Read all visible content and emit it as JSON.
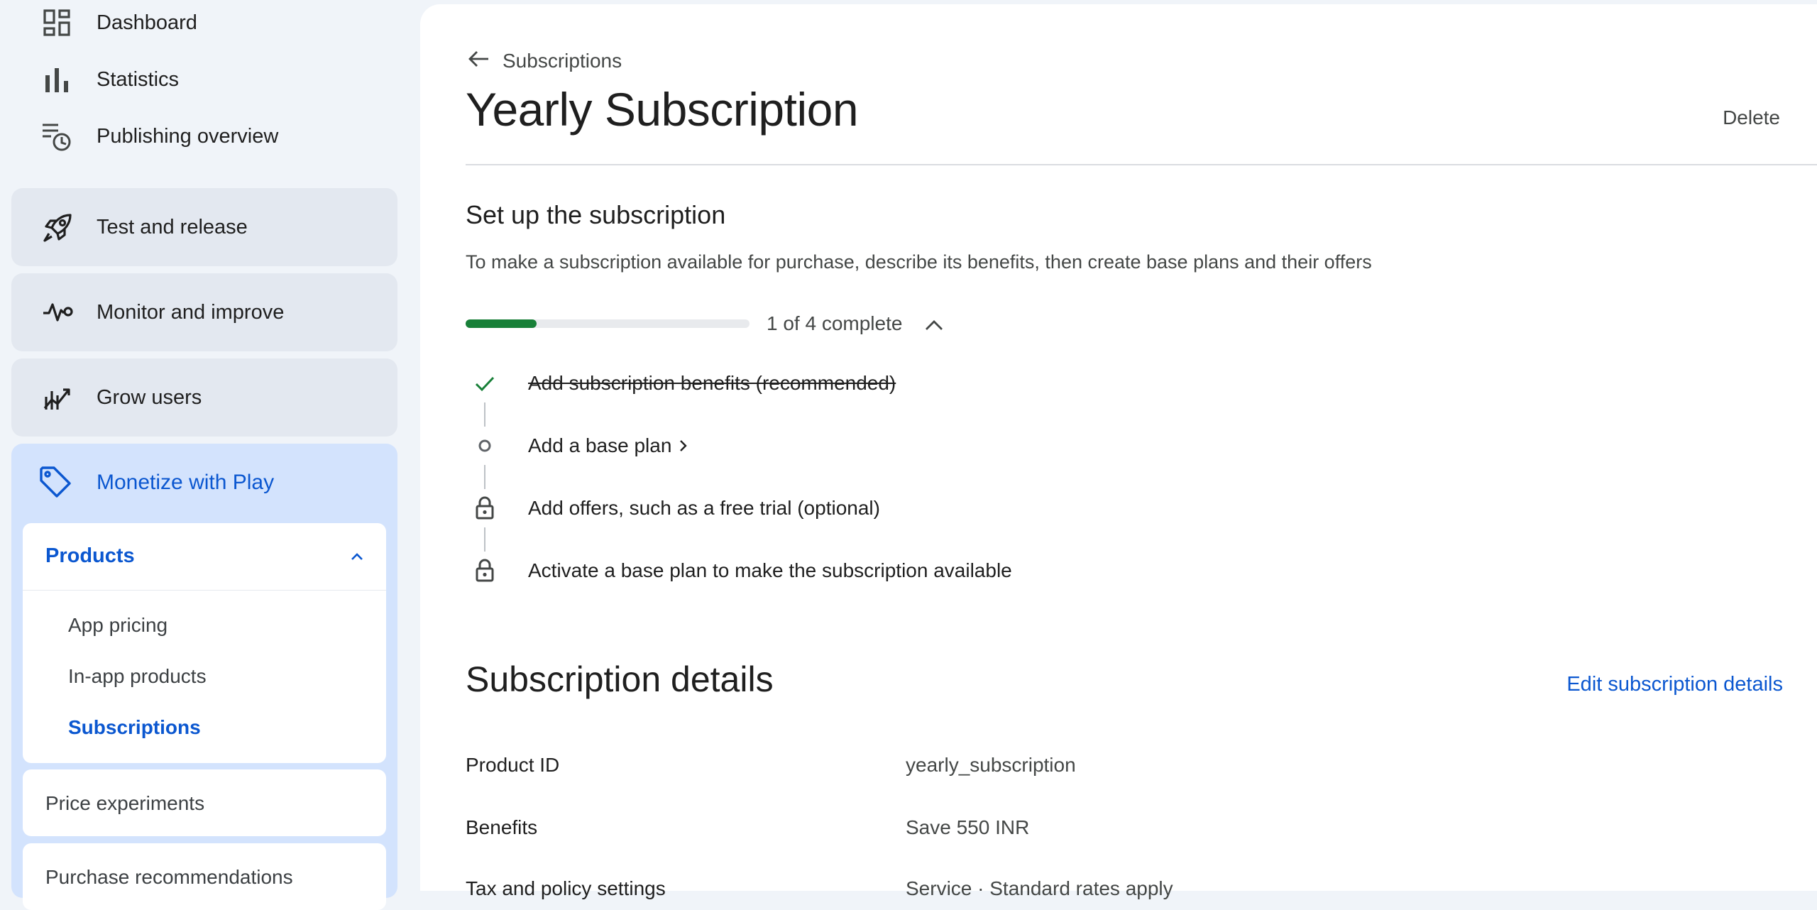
{
  "sidebar": {
    "top_items": [
      {
        "label": "Dashboard",
        "icon": "dashboard-icon"
      },
      {
        "label": "Statistics",
        "icon": "bar-chart-icon"
      },
      {
        "label": "Publishing overview",
        "icon": "publishing-clock-icon"
      }
    ],
    "sections": [
      {
        "label": "Test and release",
        "icon": "rocket-icon"
      },
      {
        "label": "Monitor and improve",
        "icon": "vitals-icon"
      },
      {
        "label": "Grow users",
        "icon": "grow-chart-icon"
      }
    ],
    "monetize": {
      "label": "Monetize with Play",
      "icon": "tag-icon",
      "products": {
        "label": "Products",
        "items": [
          "App pricing",
          "In-app products",
          "Subscriptions"
        ],
        "active": "Subscriptions"
      },
      "more": [
        "Price experiments",
        "Purchase recommendations"
      ]
    }
  },
  "main": {
    "breadcrumb": "Subscriptions",
    "title": "Yearly Subscription",
    "delete_label": "Delete",
    "setup": {
      "title": "Set up the subscription",
      "description": "To make a subscription available for purchase, describe its benefits, then create base plans and their offers",
      "progress_text": "1 of 4 complete",
      "progress_fraction": 0.25,
      "steps": [
        {
          "label": "Add subscription benefits (recommended)",
          "state": "done"
        },
        {
          "label": "Add a base plan",
          "state": "next"
        },
        {
          "label": "Add offers, such as a free trial (optional)",
          "state": "locked"
        },
        {
          "label": "Activate a base plan to make the subscription available",
          "state": "locked"
        }
      ]
    },
    "details": {
      "title": "Subscription details",
      "edit_label": "Edit subscription details",
      "rows": [
        {
          "label": "Product ID",
          "value": "yearly_subscription"
        },
        {
          "label": "Benefits",
          "value": "Save 550 INR"
        },
        {
          "label": "Tax and policy settings",
          "value": "Service · Standard rates apply"
        }
      ]
    }
  },
  "colors": {
    "accent": "#0b57d0",
    "progress": "#188038",
    "sidebar_bg": "#f0f4f9",
    "active_section_bg": "#d3e3fd"
  }
}
